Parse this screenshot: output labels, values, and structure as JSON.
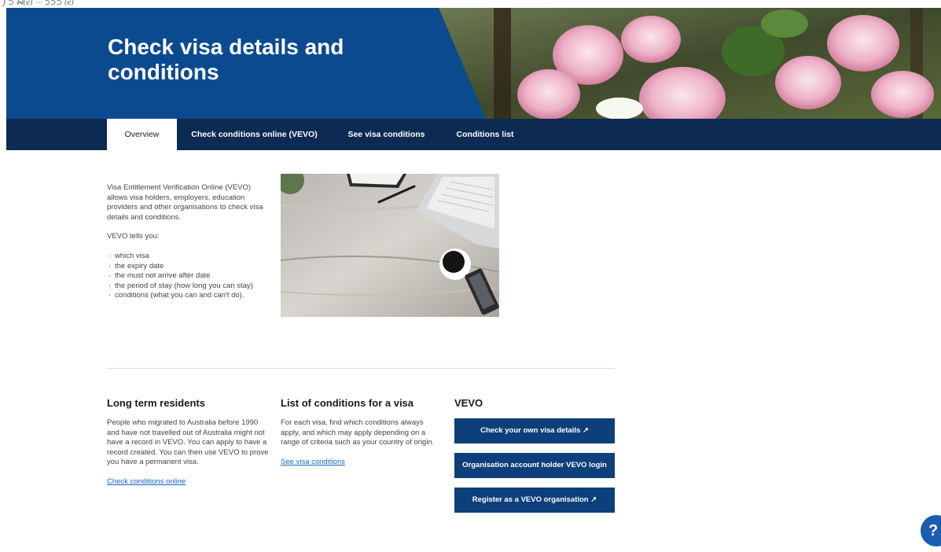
{
  "top_fragment": "ƒ  ⊃ ⋈(ϵ) ⋯ ⊃⊃⊃ (ϵ)",
  "hero": {
    "title": "Check visa details and conditions",
    "colors": {
      "banner_blue": "#0b4a8f",
      "tabbar_navy": "#0d2a52"
    }
  },
  "tabs": [
    {
      "label": "Overview",
      "active": true
    },
    {
      "label": "Check conditions online (VEVO)",
      "active": false
    },
    {
      "label": "See visa conditions",
      "active": false
    },
    {
      "label": "Conditions list",
      "active": false
    }
  ],
  "intro": {
    "paragraph": "Visa Entitlement Verification Online (VEVO) allows visa holders, employers, education providers and other organisations to check visa details and conditions.",
    "lead": "VEVO tells you:",
    "items": [
      "which visa",
      "the expiry date",
      "the must not arrive after date",
      "the period of stay (how long you can stay)",
      "conditions (what you can and can't do)."
    ]
  },
  "long_term": {
    "heading": "Long term residents",
    "body": "People who migrated to Australia before 1990 and have not travelled out of Australia might not have a record in VEVO. You can apply to have a record created. You can then use VEVO to prove you have a permanent visa.",
    "link": "Check conditions online"
  },
  "conditions_list": {
    "heading": "List of conditions for a visa",
    "body": "For each visa, find which conditions always apply, and which may apply depending on a range of criteria such as your country of origin.",
    "link": "See visa conditions"
  },
  "vevo": {
    "heading": "VEVO",
    "buttons": [
      "Check your own visa details ↗",
      "Organisation account holder VEVO login",
      "Register as a VEVO organisation ↗"
    ],
    "button_color": "#0d3f7a"
  },
  "help": {
    "label": "?"
  }
}
